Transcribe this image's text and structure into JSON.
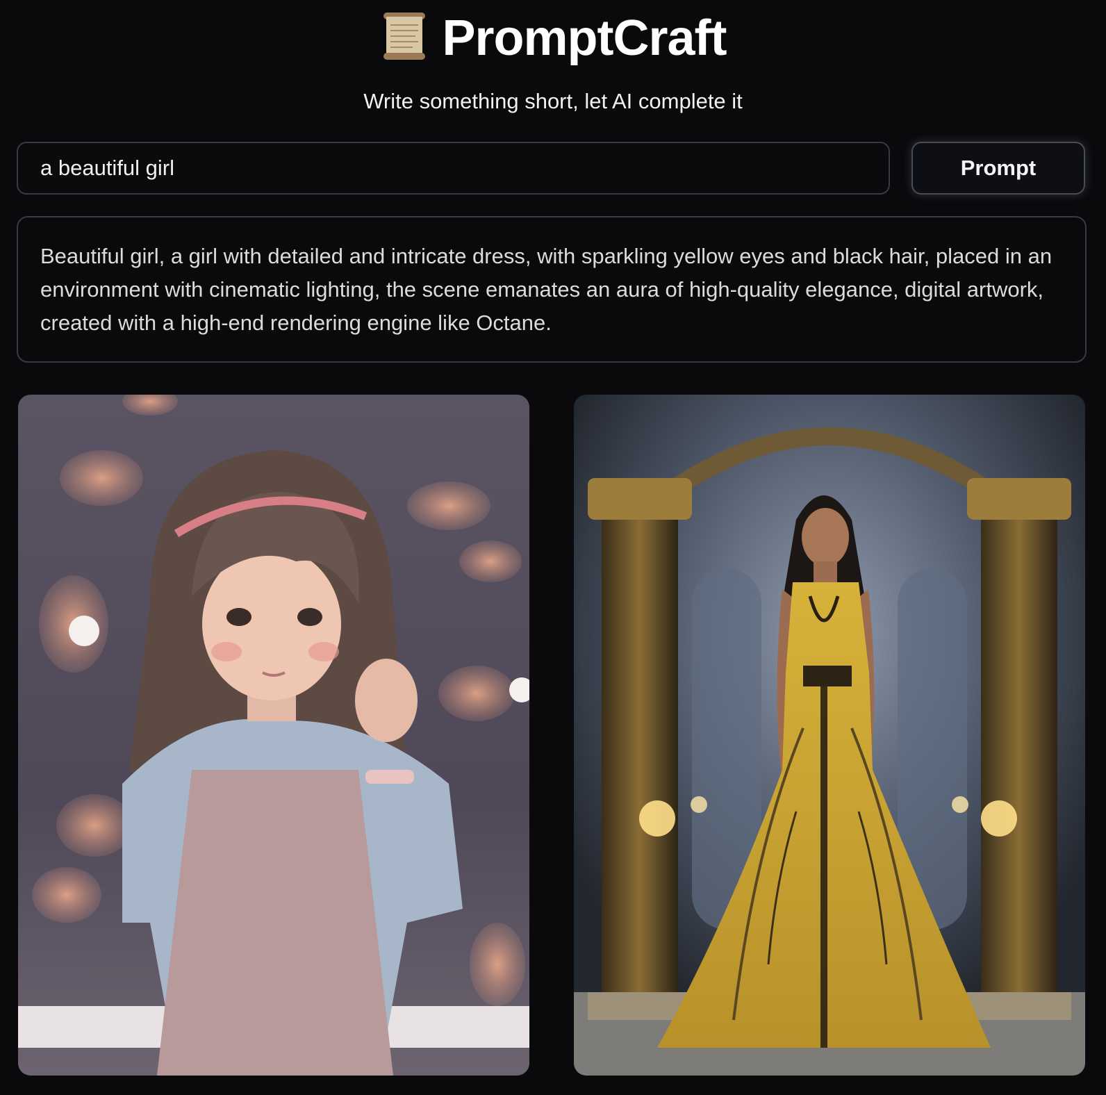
{
  "header": {
    "title": "PromptCraft",
    "icon": "scroll-icon",
    "subtitle": "Write something short, let AI complete it"
  },
  "prompt_form": {
    "input_value": "a beautiful girl",
    "button_label": "Prompt"
  },
  "output": {
    "text": "Beautiful girl, a girl with detailed and intricate dress, with sparkling yellow eyes and black hair, placed in an environment with cinematic lighting, the scene emanates an aura of high-quality elegance, digital artwork, created with a high-end rendering engine like Octane."
  },
  "gallery": {
    "images": [
      {
        "subject": "anime-style girl with brown hair and pink headband, light blue blouse, muted mauve background with orange petals"
      },
      {
        "subject": "woman with black hair in a golden yellow lace gown standing in an ornate palace hall with gold columns and candles"
      }
    ]
  },
  "colors": {
    "background": "#0a0a0d",
    "border": "#3a3b40",
    "text": "#ececec",
    "gown_gold": "#c9a62c"
  }
}
